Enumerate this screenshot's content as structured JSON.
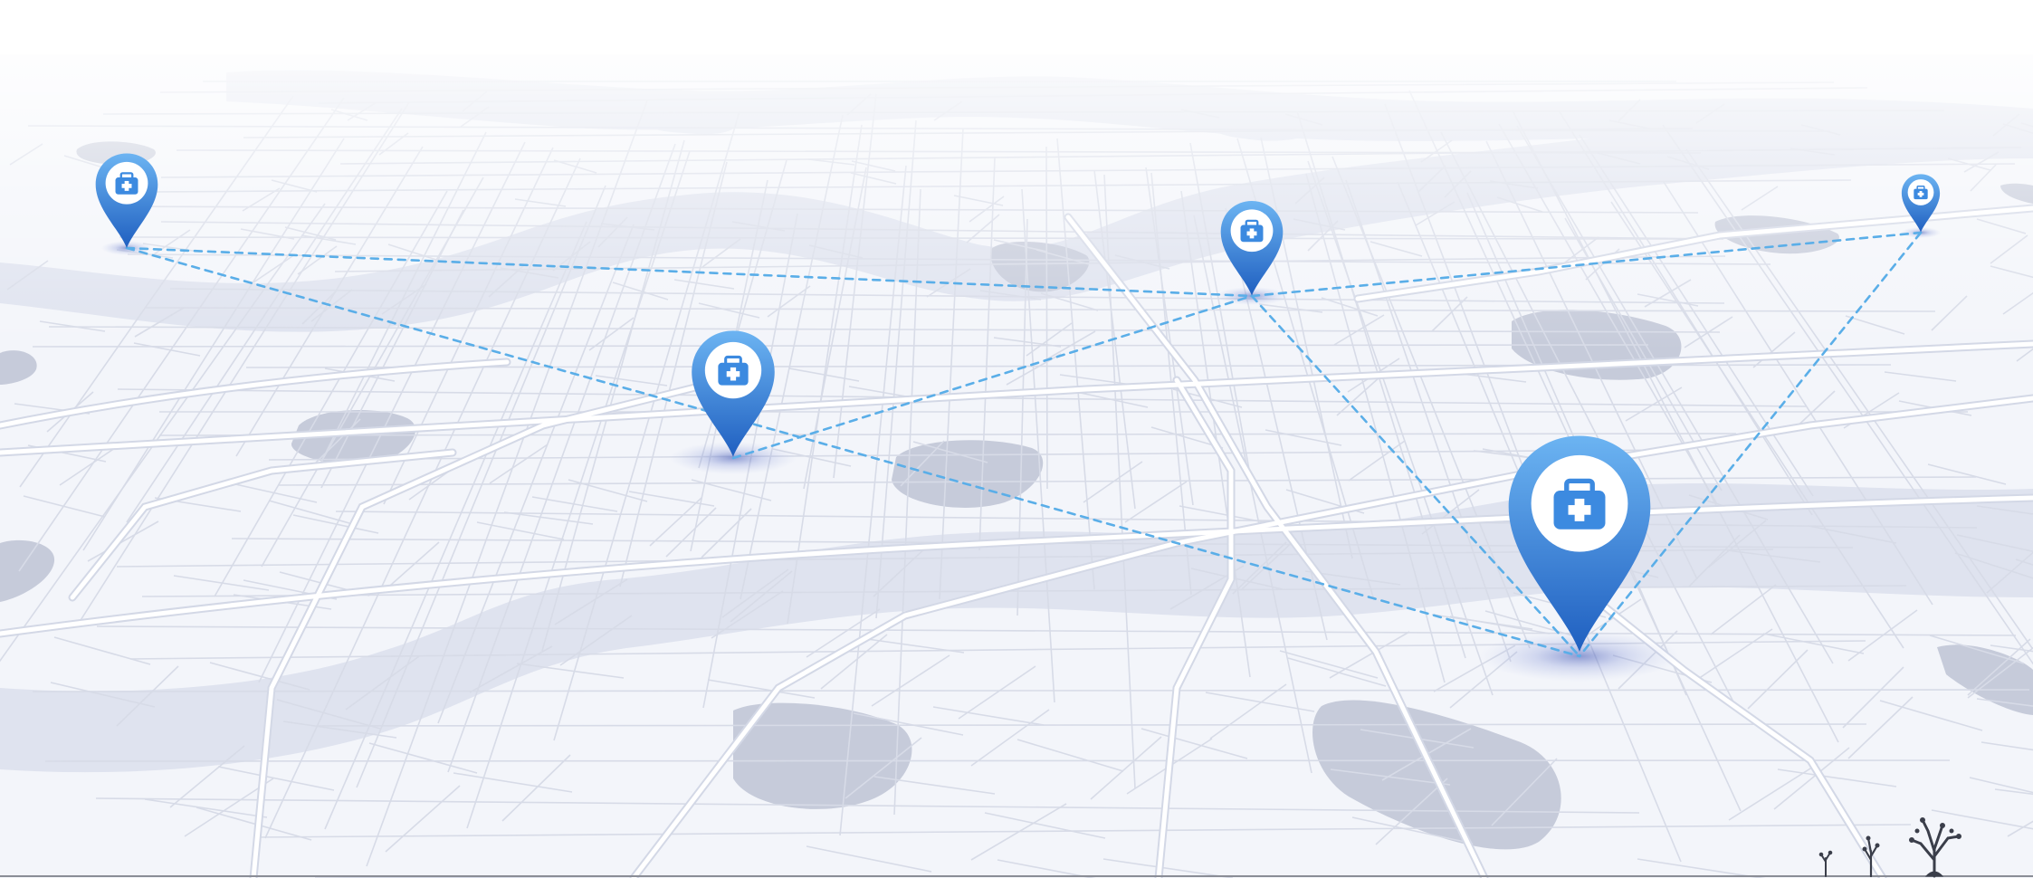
{
  "map": {
    "style": "isometric city street map",
    "colors": {
      "background": "#ffffff",
      "land": "#f2f4f9",
      "water": "#dde1ee",
      "park": "#c3c8d8",
      "road_major": "#ffffff",
      "road_minor": "#d3d8e6",
      "route": "#5aaee8",
      "pin_top": "#6cb4f2",
      "pin_bottom": "#1f5fc0",
      "pin_inner": "#ffffff",
      "icon": "#3c8ae0"
    },
    "pins": [
      {
        "id": "pin-hospital-far-left",
        "icon": "medical-bag-icon"
      },
      {
        "id": "pin-hospital-center-left",
        "icon": "medical-bag-icon"
      },
      {
        "id": "pin-hospital-center-top",
        "icon": "medical-bag-icon"
      },
      {
        "id": "pin-hospital-far-right",
        "icon": "medical-bag-icon"
      },
      {
        "id": "pin-hospital-main",
        "icon": "medical-bag-icon"
      }
    ],
    "routes": [
      {
        "from": "pin-hospital-far-left",
        "to": "pin-hospital-center-top"
      },
      {
        "from": "pin-hospital-far-left",
        "to": "pin-hospital-main"
      },
      {
        "from": "pin-hospital-center-left",
        "to": "pin-hospital-center-top"
      },
      {
        "from": "pin-hospital-center-top",
        "to": "pin-hospital-far-right"
      },
      {
        "from": "pin-hospital-center-top",
        "to": "pin-hospital-main"
      },
      {
        "from": "pin-hospital-far-right",
        "to": "pin-hospital-main"
      }
    ],
    "decorations": [
      "tree-icon",
      "sapling-icon"
    ]
  }
}
